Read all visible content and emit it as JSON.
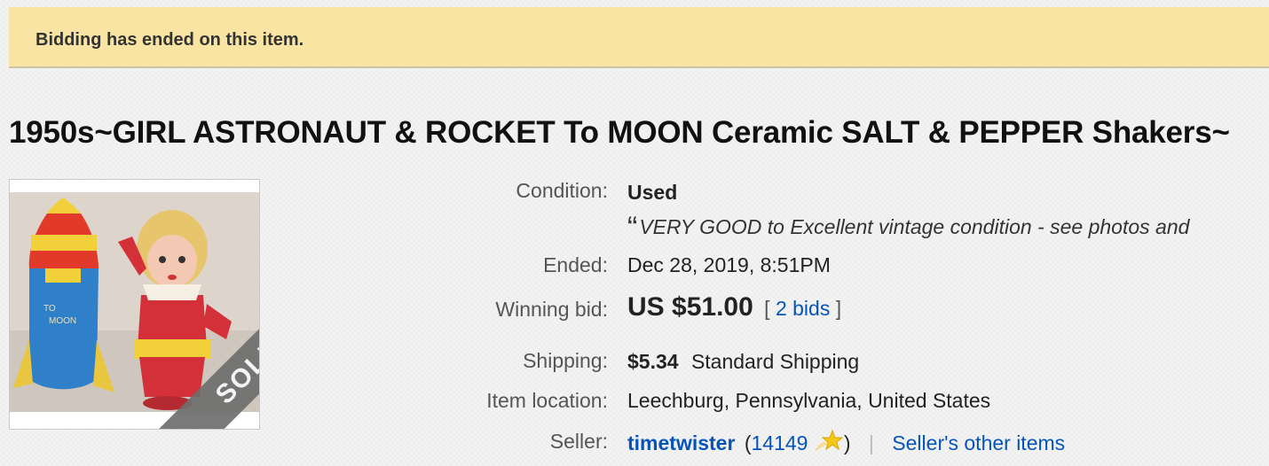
{
  "banner": {
    "text": "Bidding has ended on this item."
  },
  "item": {
    "title": "1950s~GIRL ASTRONAUT & ROCKET To MOON Ceramic SALT & PEPPER Shakers~",
    "image": {
      "overlay_label": "SOLD"
    }
  },
  "details": {
    "condition": {
      "label": "Condition:",
      "value": "Used",
      "quote_mark": "“",
      "description": "VERY GOOD to Excellent vintage condition - see photos and"
    },
    "ended": {
      "label": "Ended:",
      "date": "Dec 28, 2019",
      "time": "8:51PM"
    },
    "winning_bid": {
      "label": "Winning bid:",
      "price": "US $51.00",
      "bids_open": "[",
      "bids_link": "2 bids",
      "bids_close": "]"
    },
    "shipping": {
      "label": "Shipping:",
      "cost": "$5.34",
      "method": "Standard Shipping"
    },
    "location": {
      "label": "Item location:",
      "value": "Leechburg, Pennsylvania, United States"
    },
    "seller": {
      "label": "Seller:",
      "name": "timetwister",
      "open_paren": "(",
      "feedback": "14149",
      "close_paren": ")",
      "separator": "|",
      "other_items_link": "Seller's other items"
    }
  },
  "colors": {
    "banner_bg": "#fae4a4",
    "link": "#0654ba",
    "feedback_star": "#f5c518"
  },
  "icons": {
    "feedback_star": "shooting-star-icon"
  }
}
